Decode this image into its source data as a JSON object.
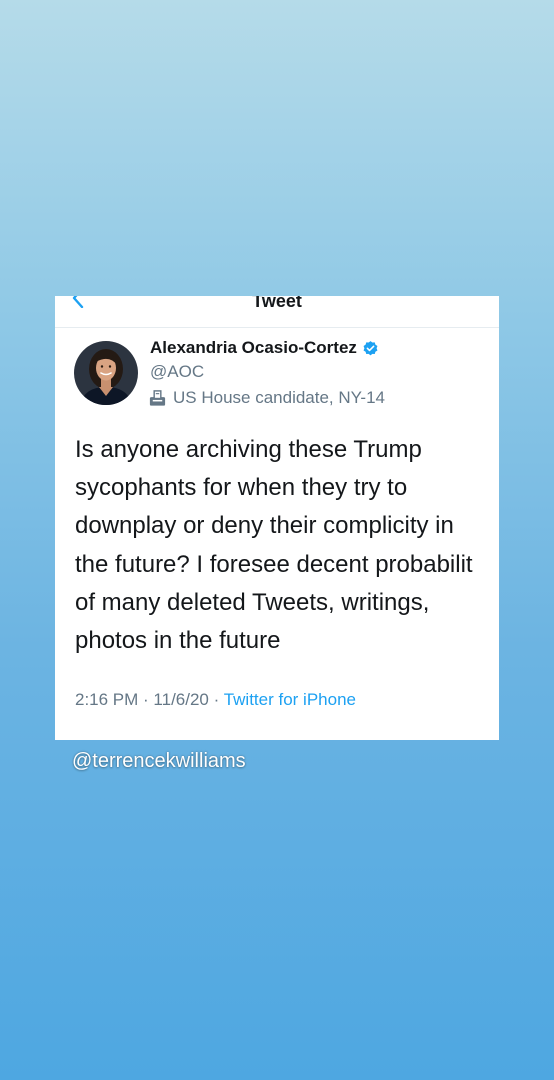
{
  "nav": {
    "title": "Tweet",
    "back_icon": "chevron-left-icon"
  },
  "author": {
    "name": "Alexandria Ocasio-Cortez",
    "handle": "@AOC",
    "verified_icon": "verified-badge-icon",
    "label_icon": "ballot-box-icon",
    "label": "US House candidate, NY-14"
  },
  "tweet": {
    "lines": [
      "Is anyone archiving these Trump",
      "sycophants for when they try to",
      "downplay or deny their complicity in",
      "the future? I foresee decent probabilit",
      "of many deleted Tweets, writings,",
      "photos in the future"
    ],
    "time": "2:16 PM",
    "date": "11/6/20",
    "source": "Twitter for iPhone"
  },
  "watermark": "@terrencekwilliams",
  "colors": {
    "accent": "#1da1f2",
    "text_primary": "#14171a",
    "text_secondary": "#657786",
    "background_top": "#b5dbe9",
    "background_bottom": "#4ea7e1"
  }
}
